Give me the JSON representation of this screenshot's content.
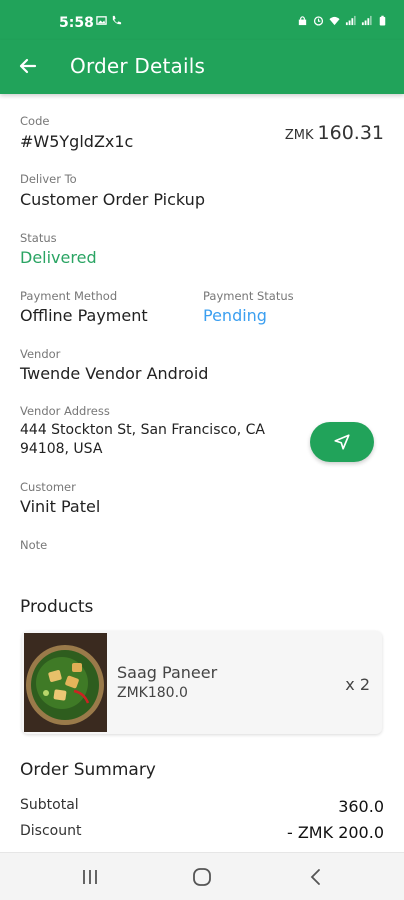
{
  "status_bar": {
    "time": "5:58"
  },
  "app_bar": {
    "title": "Order Details"
  },
  "order": {
    "code_label": "Code",
    "code": "#W5YgldZx1c",
    "amount_currency": "ZMK",
    "amount": "160.31",
    "deliver_to_label": "Deliver To",
    "deliver_to": "Customer Order Pickup",
    "status_label": "Status",
    "status": "Delivered",
    "payment_method_label": "Payment Method",
    "payment_method": "Offline Payment",
    "payment_status_label": "Payment Status",
    "payment_status": "Pending",
    "vendor_label": "Vendor",
    "vendor": "Twende Vendor Android",
    "vendor_address_label": "Vendor Address",
    "vendor_address_line1": "444 Stockton St, San Francisco, CA",
    "vendor_address_line2": "94108, USA",
    "customer_label": "Customer",
    "customer": "Vinit Patel",
    "note_label": "Note"
  },
  "products": {
    "title": "Products",
    "items": [
      {
        "name": "Saag Paneer",
        "price": "ZMK180.0",
        "qty": "x 2"
      }
    ]
  },
  "summary": {
    "title": "Order Summary",
    "subtotal_label": "Subtotal",
    "subtotal": "360.0",
    "discount_label": "Discount",
    "discount": "- ZMK 200.0"
  },
  "colors": {
    "brand": "#21a35a",
    "status_green": "#2aa463",
    "pending_blue": "#3b9ff0"
  }
}
